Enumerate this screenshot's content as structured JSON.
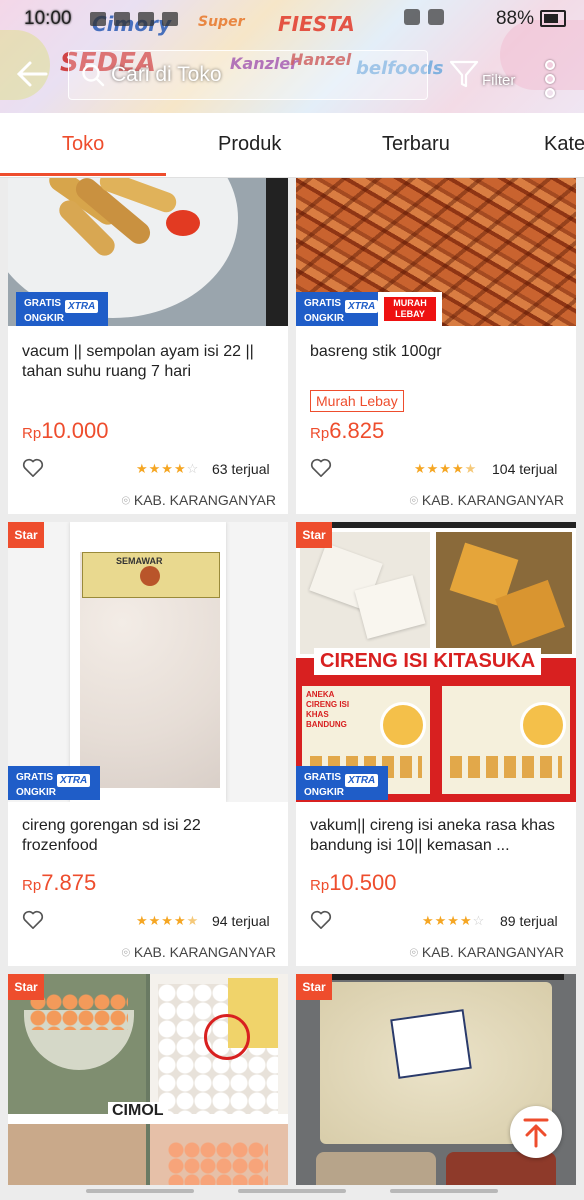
{
  "status_bar": {
    "time": "10:00",
    "battery": "88%"
  },
  "header": {
    "search_placeholder": "Cari di Toko",
    "filter_label": "Filter",
    "banner_brands": [
      "Cimory",
      "SEDEA",
      "Super",
      "FIESTA",
      "Kanzler",
      "Hanzel",
      "belfoods"
    ]
  },
  "tabs": [
    {
      "label": "Toko",
      "active": true
    },
    {
      "label": "Produk",
      "active": false
    },
    {
      "label": "Terbaru",
      "active": false
    },
    {
      "label": "Kate",
      "active": false
    }
  ],
  "badges": {
    "gratis_line1": "GRATIS",
    "gratis_line2": "ONGKIR",
    "xtra": "XTRA",
    "murah_line1": "MURAH",
    "murah_line2": "LEBAY",
    "star": "Star"
  },
  "products": [
    {
      "title": "vacum || sempolan ayam isi 22 || tahan suhu ruang 7 hari",
      "currency": "Rp",
      "price": "10.000",
      "rating": 4,
      "sold": "63 terjual",
      "location": "KAB. KARANGANYAR",
      "badge": "",
      "star": false
    },
    {
      "title": "basreng stik 100gr",
      "currency": "Rp",
      "price": "6.825",
      "rating": 4.5,
      "sold": "104 terjual",
      "location": "KAB. KARANGANYAR",
      "badge": "Murah Lebay",
      "star": false
    },
    {
      "title": "cireng gorengan sd isi 22 frozenfood",
      "currency": "Rp",
      "price": "7.875",
      "rating": 4.5,
      "sold": "94 terjual",
      "location": "KAB. KARANGANYAR",
      "badge": "",
      "star": true,
      "package_label": "SEMAWAR"
    },
    {
      "title": "vakum|| cireng isi aneka rasa khas bandung isi 10|| kemasan ...",
      "currency": "Rp",
      "price": "10.500",
      "rating": 4,
      "sold": "89 terjual",
      "location": "KAB. KARANGANYAR",
      "badge": "",
      "star": true,
      "poster_title": "CIRENG ISI KITASUKA",
      "poster_sub": "ANEKA CIRENG ISI KHAS BANDUNG"
    },
    {
      "star": true,
      "image_text": "CIMOL"
    },
    {
      "star": true
    }
  ],
  "colors": {
    "accent": "#ee4d2d",
    "gratis_blue": "#1f5dc8",
    "star_yellow": "#f5a623"
  },
  "icons": [
    "back-arrow-icon",
    "search-icon",
    "filter-icon",
    "more-vertical-icon",
    "heart-icon",
    "location-pin-icon",
    "scroll-top-icon"
  ]
}
